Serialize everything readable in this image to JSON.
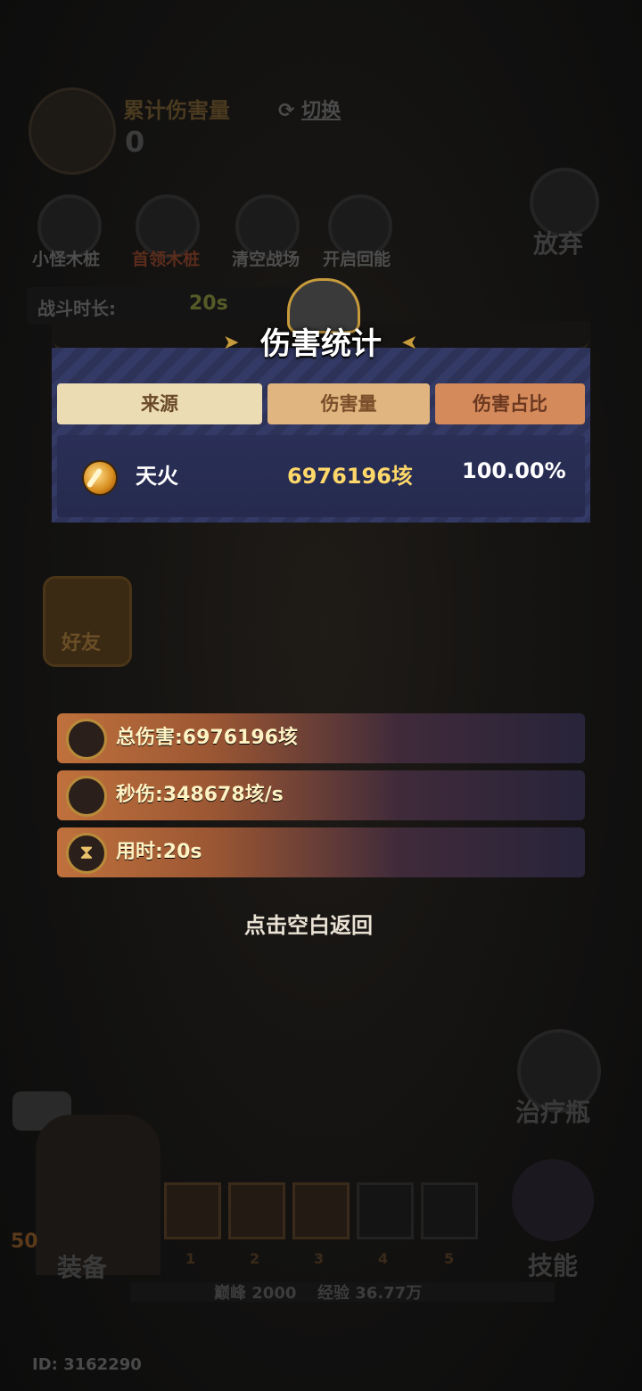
{
  "hud": {
    "cumulative_label": "累计伤害量",
    "cumulative_value": "0",
    "switch_label": "切换",
    "abandon_label": "放弃",
    "tools": [
      "小怪木桩",
      "首领木桩",
      "清空战场",
      "开启回能"
    ],
    "battle_time_label": "战斗时长:",
    "battle_time_value": "20s",
    "friends_label": "好友",
    "heal_label": "治疗瓶",
    "equip_label": "装备",
    "skill_label": "技能",
    "level": "50",
    "slots": [
      "1",
      "2",
      "3",
      "4",
      "5"
    ],
    "peak_label": "巅峰 2000",
    "exp_label": "经验 36.77万",
    "user_id": "ID: 3162290"
  },
  "modal": {
    "title": "伤害统计",
    "columns": [
      "来源",
      "伤害量",
      "伤害占比"
    ],
    "rows": [
      {
        "icon": "fire-orb-icon",
        "source": "天火",
        "damage": "6976196垓",
        "share": "100.00%"
      }
    ],
    "total_damage": "总伤害:6976196垓",
    "dps": "秒伤:348678垓/s",
    "time_used": "用时:20s",
    "return_hint": "点击空白返回"
  },
  "colors": {
    "header_source": "#ecdcb4",
    "header_damage": "#e1b57f",
    "header_share": "#d48a5a",
    "damage_gold": "#ffd86a",
    "panel_navy": "#2d3258"
  }
}
